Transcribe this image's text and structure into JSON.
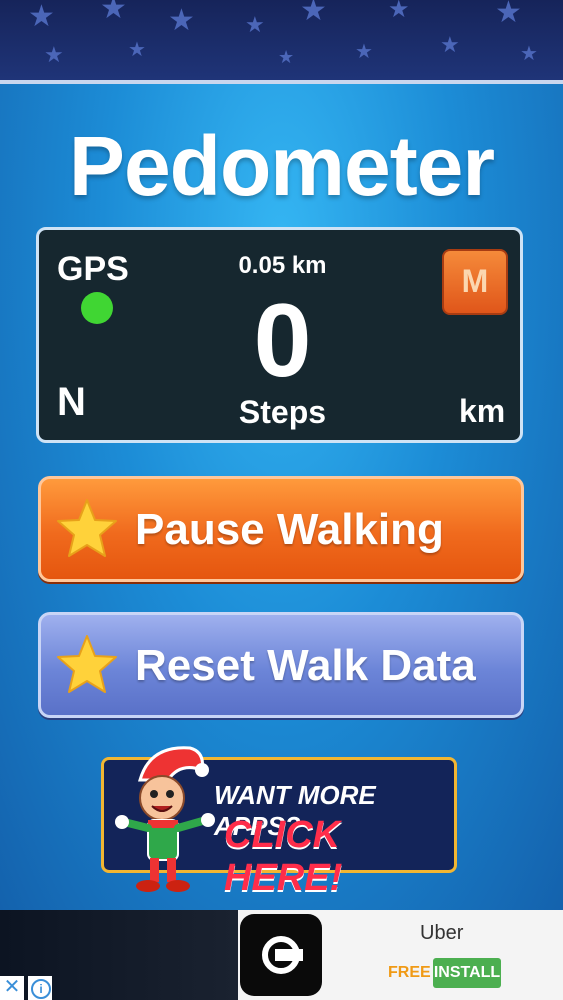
{
  "app": {
    "title": "Pedometer"
  },
  "stats": {
    "gps_label": "GPS",
    "gps_status_color": "#40d633",
    "distance": "0.05 km",
    "mode_button_label": "M",
    "step_count": "0",
    "steps_label": "Steps",
    "direction": "N",
    "unit_label": "km"
  },
  "actions": {
    "pause_label": "Pause Walking",
    "reset_label": "Reset Walk Data",
    "icon": "star-icon"
  },
  "promo": {
    "line1": "WANT MORE APPS?",
    "line2": "CLICK HERE!"
  },
  "ad": {
    "title": "Uber",
    "free_label": "FREE",
    "install_label": "INSTALL",
    "close_icon": "close-icon",
    "info_icon": "info-icon"
  },
  "colors": {
    "accent_orange": "#f06a1d",
    "accent_blue": "#6c85d8",
    "panel_bg": "#16272f",
    "background_blue": "#1c8cd6"
  }
}
